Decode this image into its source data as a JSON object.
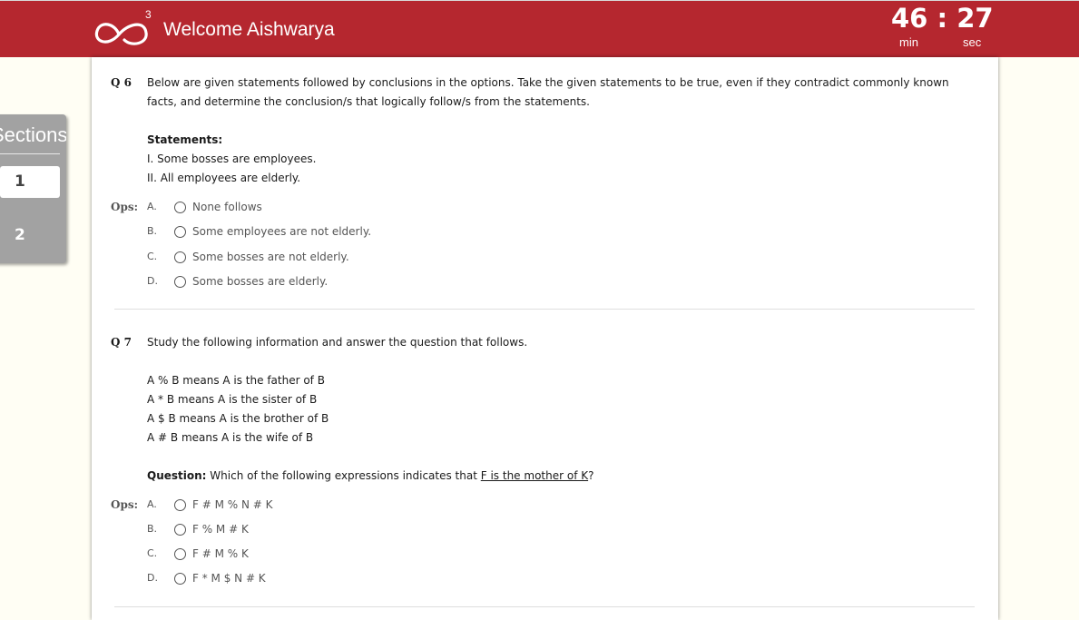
{
  "header": {
    "logo_superscript": "3",
    "welcome": "Welcome Aishwarya",
    "timer": {
      "minutes": "46",
      "separator": ":",
      "seconds": "27",
      "min_label": "min",
      "sec_label": "sec"
    }
  },
  "sections": {
    "title": "Sections",
    "items": [
      {
        "label": "1",
        "active": true
      },
      {
        "label": "2",
        "active": false
      }
    ]
  },
  "questions": [
    {
      "number": "Q 6",
      "text": "Below are given statements followed by conclusions in the options. Take the given statements to be true, even if they contradict commonly known facts, and determine the conclusion/s that logically follow/s from the statements.",
      "statements_heading": "Statements:",
      "statements": [
        "I. Some bosses are employees.",
        "II. All employees are elderly."
      ],
      "ops_label": "Ops:",
      "options": [
        {
          "letter": "A.",
          "text": "None follows"
        },
        {
          "letter": "B.",
          "text": "Some employees are not elderly."
        },
        {
          "letter": "C.",
          "text": "Some bosses are not elderly."
        },
        {
          "letter": "D.",
          "text": "Some bosses are elderly."
        }
      ]
    },
    {
      "number": "Q 7",
      "text": "Study the following information and answer the question that follows.",
      "info": [
        "A % B means A is the father of B",
        "A * B means A is the sister of B",
        "A $ B means A is the brother of B",
        "A # B means A is the wife of B"
      ],
      "question_label": "Question:",
      "question_prefix": "Which of the following expressions indicates that ",
      "question_underlined": "F is the mother of K",
      "question_suffix": "?",
      "ops_label": "Ops:",
      "options": [
        {
          "letter": "A.",
          "text": "F # M % N # K"
        },
        {
          "letter": "B.",
          "text": "F % M # K"
        },
        {
          "letter": "C.",
          "text": "F # M % K"
        },
        {
          "letter": "D.",
          "text": "F * M $ N # K"
        }
      ]
    }
  ],
  "colors": {
    "header": "#b5272f",
    "sections_bg": "#a2a2a2",
    "page_bg": "#fffef4"
  }
}
